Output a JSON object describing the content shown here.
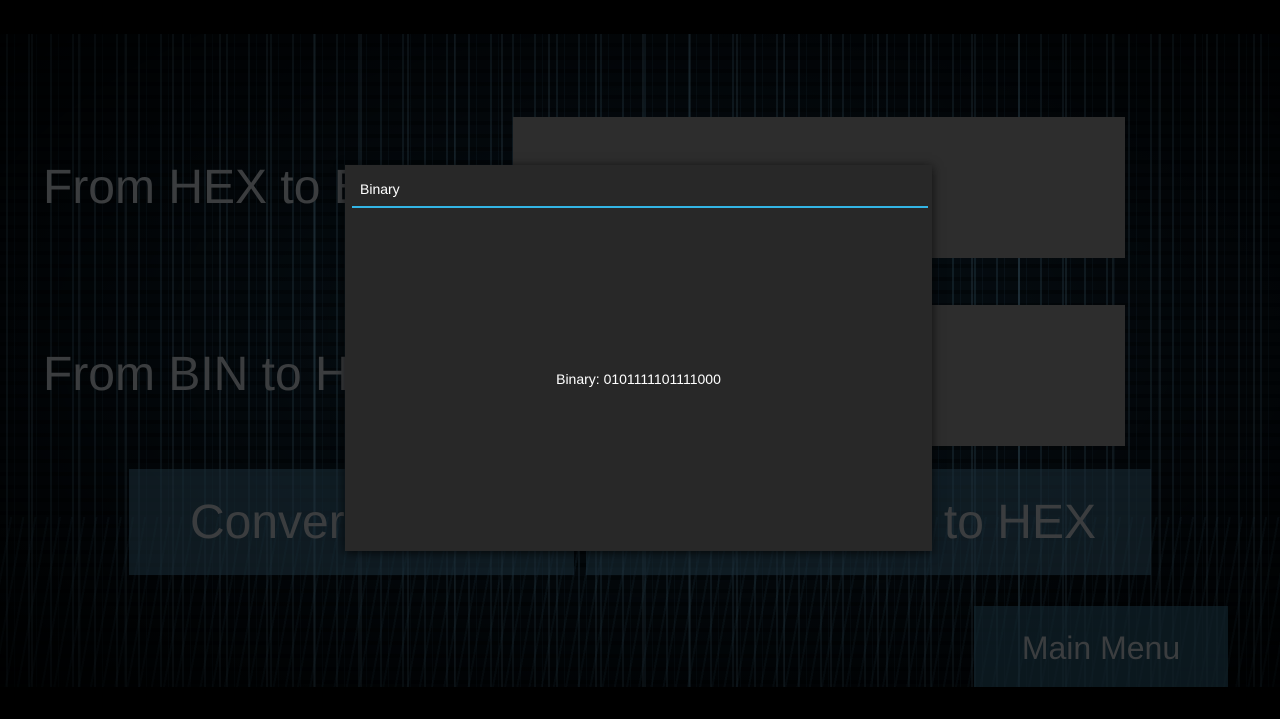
{
  "app": {
    "hex_row_label": "From HEX to BIN",
    "bin_row_label": "From BIN to HEX",
    "convert_left_label": "Convert to BIN",
    "convert_right_label": "Convert BIN to HEX",
    "main_menu_label": "Main Menu",
    "hex_input_value": "",
    "bin_input_value": ""
  },
  "dialog": {
    "title": "Binary",
    "message": "Binary: 0101111101111000",
    "divider_color": "#33b5e5"
  },
  "colors": {
    "dialog_background": "#282828",
    "input_background": "#454545",
    "dim_text": "#5b5f61"
  }
}
